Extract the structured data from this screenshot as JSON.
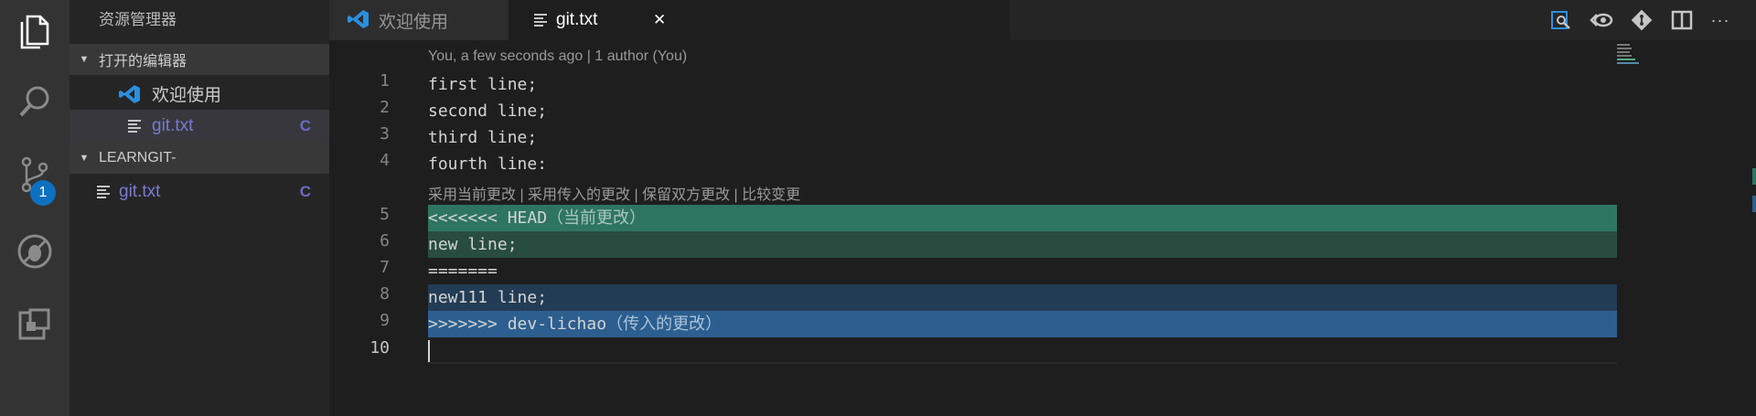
{
  "colors": {
    "accent": "#0e70c0",
    "current_change_header": "#2e7561",
    "current_change": "#284d40",
    "incoming_change": "#233c55",
    "incoming_change_header": "#2c5f8f",
    "file_status": "#6c6cc4"
  },
  "activity_bar": {
    "icons": [
      "explorer-icon",
      "search-icon",
      "source-control-icon",
      "debug-icon",
      "extensions-icon"
    ],
    "scm_badge": "1"
  },
  "sidebar": {
    "title": "资源管理器",
    "open_editors": {
      "label": "打开的编辑器",
      "items": [
        {
          "name": "欢迎使用",
          "icon": "vscode-icon",
          "status": ""
        },
        {
          "name": "git.txt",
          "icon": "file-lines-icon",
          "status": "C"
        }
      ]
    },
    "project": {
      "label": "LEARNGIT-",
      "items": [
        {
          "name": "git.txt",
          "icon": "file-lines-icon",
          "status": "C"
        }
      ]
    }
  },
  "tabs": [
    {
      "label": "欢迎使用",
      "icon": "vscode-icon",
      "active": false
    },
    {
      "label": "git.txt",
      "icon": "file-lines-icon",
      "active": true,
      "close": "✕"
    }
  ],
  "toolbar_icons": [
    "open-changes-icon",
    "previous-change-icon",
    "git-icon",
    "split-editor-icon",
    "more-icon"
  ],
  "toolbar": {
    "more": "···"
  },
  "editor": {
    "blame": "You, a few seconds ago | 1 author (You)",
    "codelens": "采用当前更改 | 采用传入的更改 | 保留双方更改 | 比较变更",
    "lines": [
      {
        "n": "1",
        "text": "first line;"
      },
      {
        "n": "2",
        "text": "second line;"
      },
      {
        "n": "3",
        "text": "third line;"
      },
      {
        "n": "4",
        "text": "fourth line:"
      },
      {
        "n": "5",
        "text": "<<<<<<< HEAD",
        "suffix": "（当前更改）"
      },
      {
        "n": "6",
        "text": "new line;"
      },
      {
        "n": "7",
        "text": "======="
      },
      {
        "n": "8",
        "text": "new111 line;"
      },
      {
        "n": "9",
        "text": ">>>>>>> dev-lichao",
        "suffix": "（传入的更改）"
      },
      {
        "n": "10",
        "text": ""
      }
    ]
  }
}
